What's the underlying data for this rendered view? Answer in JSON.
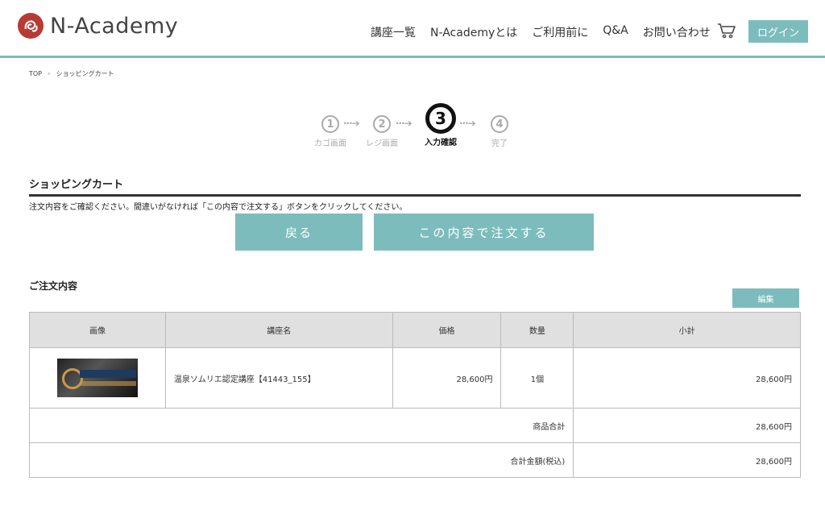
{
  "header": {
    "logo_text": "N-Academy",
    "nav": [
      "講座一覧",
      "N-Academyとは",
      "ご利用前に",
      "Q&A",
      "お問い合わせ"
    ],
    "login_label": "ログイン"
  },
  "breadcrumb": {
    "home": "TOP",
    "current": "ショッピングカート"
  },
  "steps": [
    {
      "number": "1",
      "label": "カゴ画面"
    },
    {
      "number": "2",
      "label": "レジ画面"
    },
    {
      "number": "3",
      "label": "入力確認"
    },
    {
      "number": "4",
      "label": "完了"
    }
  ],
  "active_step": 3,
  "section": {
    "title": "ショッピングカート",
    "instruction": "注文内容をご確認ください。間違いがなければ「この内容で注文する」ボタンをクリックしてください。"
  },
  "buttons": {
    "back": "戻る",
    "order": "この内容で注文する",
    "edit": "編集"
  },
  "order": {
    "title": "ご注文内容",
    "columns": [
      "画像",
      "講座名",
      "価格",
      "数量",
      "小計"
    ],
    "items": [
      {
        "name": "温泉ソムリエ認定講座【41443_155】",
        "price": "28,600円",
        "quantity": "1個",
        "subtotal": "28,600円"
      }
    ],
    "product_total_label": "商品合計",
    "product_total": "28,600円",
    "grand_total_label": "合計金額(税込)",
    "grand_total": "28,600円"
  },
  "colors": {
    "accent": "#7dbcbd",
    "logo_red": "#b73a35"
  }
}
